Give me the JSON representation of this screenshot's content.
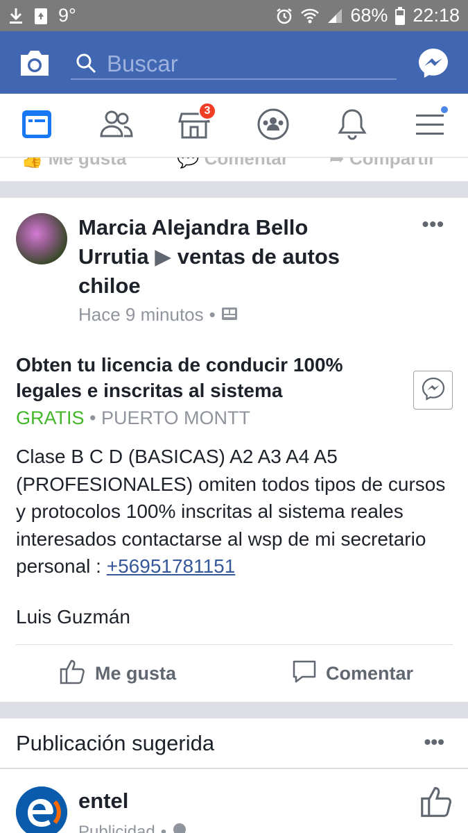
{
  "status_bar": {
    "notification_icons": [
      "download-icon",
      "recycle-icon"
    ],
    "temperature": "9°",
    "right_icons": [
      "alarm-icon",
      "wifi-icon",
      "signal-icon"
    ],
    "battery": "68%",
    "time": "22:18"
  },
  "top_bar": {
    "search_placeholder": "Buscar",
    "color": "#4267b2"
  },
  "nav": {
    "items": [
      {
        "name": "news-feed",
        "icon": "news-feed-icon",
        "active": true
      },
      {
        "name": "friends",
        "icon": "friends-icon"
      },
      {
        "name": "marketplace",
        "icon": "marketplace-icon",
        "badge": "3"
      },
      {
        "name": "groups",
        "icon": "groups-icon"
      },
      {
        "name": "notifications",
        "icon": "bell-icon"
      },
      {
        "name": "menu",
        "icon": "menu-icon",
        "dot": true
      }
    ]
  },
  "prev_post": {
    "like": "Me gusta",
    "comment": "Comentar",
    "share": "Compartir"
  },
  "post": {
    "author_line1": "Marcia Alejandra Bello",
    "author_line2_name": "Urrutia",
    "group_line": "ventas de autos",
    "group_line2": "chiloe",
    "time": "Hace 9 minutos",
    "headline": "Obten tu licencia de conducir 100% legales e inscritas al sistema",
    "price": "GRATIS",
    "location": "PUERTO MONTT",
    "body": "Clase B C D (BASICAS) A2 A3 A4 A5 (PROFESIONALES) omiten todos tipos de cursos y protocolos 100% inscritas al sistema reales interesados contactarse al wsp de mi secretario personal : ",
    "phone": "+56951781151",
    "signoff": "Luis Guzmán",
    "like_label": "Me gusta",
    "comment_label": "Comentar"
  },
  "suggested": {
    "title": "Publicación sugerida",
    "page_name": "entel",
    "sub": "Publicidad"
  },
  "colors": {
    "accent": "#4267b2",
    "price_green": "#42b72a",
    "link": "#365899",
    "badge_red": "#f03d25"
  }
}
